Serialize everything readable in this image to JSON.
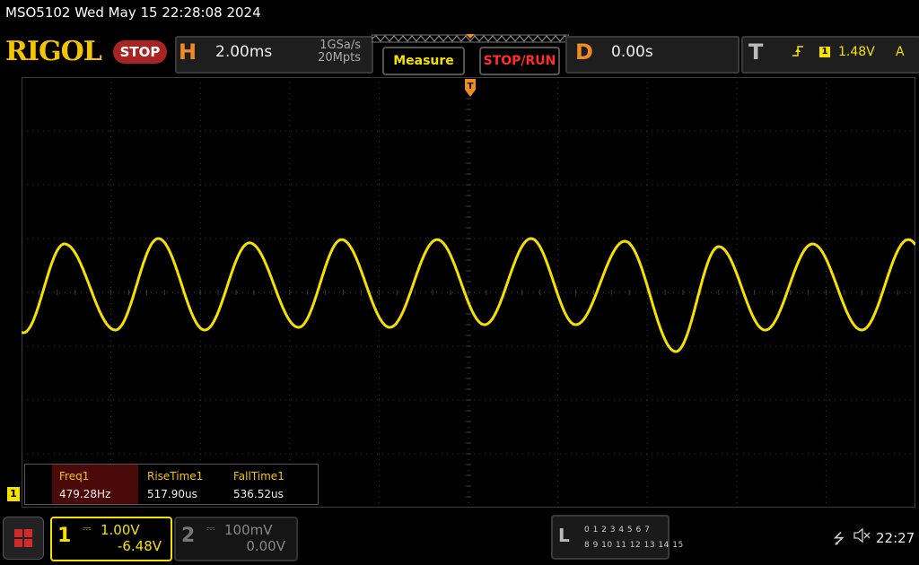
{
  "title_bar": {
    "text": "MSO5102  Wed May 15 22:28:08 2024"
  },
  "header": {
    "logo": "RIGOL",
    "run_state": "STOP",
    "horizontal": {
      "letter": "H",
      "timebase": "2.00ms",
      "sample_rate": "1GSa/s",
      "memory_depth": "20Mpts"
    },
    "measure_button": "Measure",
    "stoprun_button": "STOP/RUN",
    "delay": {
      "letter": "D",
      "value": "0.00s"
    },
    "trigger": {
      "letter": "T",
      "edge_icon": "rising-edge-icon",
      "source": "1",
      "level": "1.48V",
      "mode": "A"
    }
  },
  "measurements": [
    {
      "label": "Freq1",
      "value": "479.28Hz"
    },
    {
      "label": "RiseTime1",
      "value": "517.90us"
    },
    {
      "label": "FallTime1",
      "value": "536.52us"
    }
  ],
  "ground_marker": "1",
  "channels": {
    "ch1": {
      "number": "1",
      "scale": "1.00V",
      "offset": "-6.48V"
    },
    "ch2": {
      "number": "2",
      "scale": "100mV",
      "offset": "0.00V"
    }
  },
  "logic_analyzer": {
    "letter": "L",
    "row1": "0 1 2 3  4 5 6 7",
    "row2": "8 9 10 11 12 13 14 15"
  },
  "status": {
    "time": "22:27"
  },
  "colors": {
    "ch1": "#f5e000",
    "accent": "#f08a24",
    "stop": "#a82424",
    "grid": "#3c3c3c"
  },
  "chart_data": {
    "type": "line",
    "title": "",
    "xlabel": "",
    "ylabel": "",
    "x_divisions": 10,
    "y_divisions": 8,
    "xlim_div": [
      -5,
      5
    ],
    "ylim_div": [
      -4,
      4
    ],
    "series": [
      {
        "color": "#f5e000",
        "x_div": [
          -5.0,
          -4.5,
          -4.0,
          -3.5,
          -3.0,
          -2.5,
          -2.0,
          -1.5,
          -1.0,
          -0.5,
          0.0,
          0.5,
          1.0,
          1.5,
          2.0,
          2.5,
          3.0,
          3.5,
          4.0,
          4.5,
          5.0
        ],
        "peaks_div": [
          -4.52,
          -3.47,
          -2.45,
          -1.42,
          -0.35,
          0.7,
          1.75,
          2.8,
          3.85,
          4.92
        ],
        "troughs_div": [
          -4.98,
          -3.95,
          -2.95,
          -1.9,
          -0.88,
          0.18,
          1.2,
          2.32,
          3.32,
          4.4
        ],
        "peak_levels_div": [
          0.9,
          1.0,
          0.92,
          0.98,
          0.98,
          1.0,
          0.95,
          0.85,
          0.9,
          0.98
        ],
        "trough_levels_div": [
          -0.75,
          -0.7,
          -0.7,
          -0.65,
          -0.65,
          -0.6,
          -0.6,
          -1.1,
          -0.7,
          -0.7
        ]
      }
    ]
  }
}
